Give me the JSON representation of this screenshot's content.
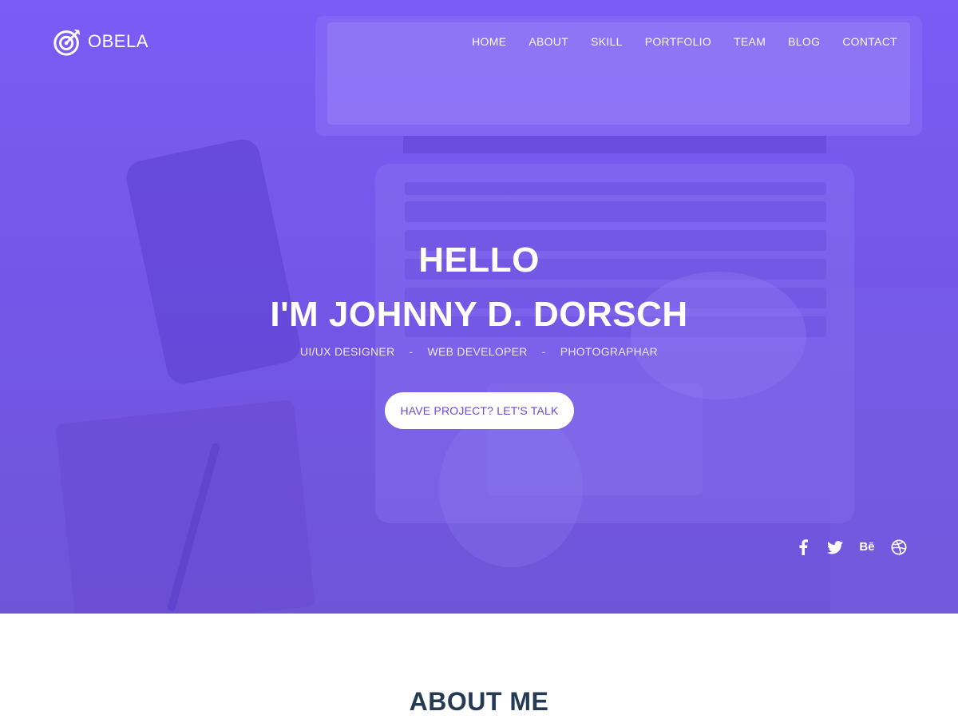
{
  "brand": {
    "name": "OBELA",
    "logo_icon": "target-arrow-icon"
  },
  "nav": {
    "items": [
      {
        "label": "HOME"
      },
      {
        "label": "ABOUT"
      },
      {
        "label": "SKILL"
      },
      {
        "label": "PORTFOLIO"
      },
      {
        "label": "TEAM"
      },
      {
        "label": "BLOG"
      },
      {
        "label": "CONTACT"
      }
    ]
  },
  "hero": {
    "greeting": "HELLO",
    "name": "I'M JOHNNY D. DORSCH",
    "roles": [
      "UI/UX DESIGNER",
      "WEB DEVELOPER",
      "PHOTOGRAPHAR"
    ],
    "role_separator": "-",
    "cta_label": "HAVE PROJECT? LET'S TALK",
    "background_icon": "laptop-desk-photo"
  },
  "social": {
    "icons": [
      "facebook-icon",
      "twitter-icon",
      "behance-icon",
      "dribbble-icon"
    ],
    "behance_text": "Bē"
  },
  "about": {
    "title": "ABOUT ME"
  },
  "colors": {
    "overlay": "#7356e6",
    "accent_text": "#6b48e0",
    "heading_dark": "#243b53",
    "white": "#ffffff"
  }
}
